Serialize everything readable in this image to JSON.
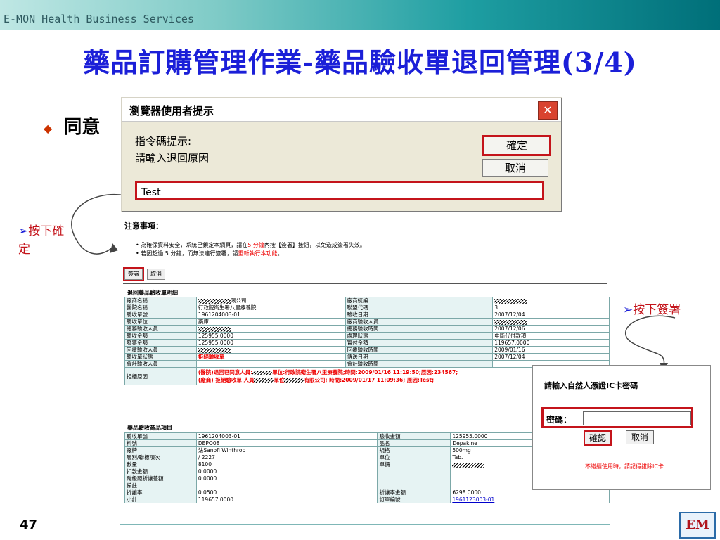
{
  "header": {
    "brand": "E-MON Health Business Services"
  },
  "title": "藥品訂購管理作業-藥品驗收單退回管理(3/4)",
  "bullet": {
    "text": "同意"
  },
  "page_number": "47",
  "logo_text": "EM",
  "annotations": {
    "press_ok": "按下確定",
    "press_sign": "按下簽署"
  },
  "dialog": {
    "caption": "瀏覽器使用者提示",
    "close_glyph": "✕",
    "prompt_label": "指令碼提示:",
    "prompt_text": "請輸入退回原因",
    "ok_label": "確定",
    "cancel_label": "取消",
    "input_value": "Test"
  },
  "notice": {
    "heading": "注意事項：",
    "line1_a": "為確保資料安全，系統已鎖定本網頁，請在",
    "line1_b": "5 分鐘",
    "line1_c": "內按【簽署】按鈕，以免造成簽署失效。",
    "line2_a": "若因超過 5 分鐘，而無法進行簽署，請",
    "line2_b": "重新執行本功能",
    "line2_c": "。",
    "sign_button": "簽署",
    "cancel_button": "取消"
  },
  "receipt": {
    "section_title": "退回藥品驗收單明細",
    "rows": [
      [
        "廠商名稱",
        "限公司",
        "廠商統編",
        ""
      ],
      [
        "醫院名稱",
        "行政院衛生署八里療養院",
        "聯盟代碼",
        "3"
      ],
      [
        "驗收單號",
        "1961204003-01",
        "驗收日期",
        "2007/12/04"
      ],
      [
        "驗收單位",
        "藥庫",
        "廠商驗收人員",
        ""
      ],
      [
        "總務驗收人員",
        "",
        "總務驗收時間",
        "2007/12/06"
      ],
      [
        "驗收金額",
        "125955.0000",
        "處理狀態",
        "中斷代付款項"
      ],
      [
        "發票金額",
        "125955.0000",
        "實付金額",
        "119657.0000"
      ],
      [
        "回覆驗收人員",
        "",
        "回覆驗收時間",
        "2009/01/16"
      ],
      [
        "驗收單狀態",
        "拒絕驗收單",
        "傳送日期",
        "2007/12/04"
      ],
      [
        "會計驗收人員",
        "",
        "會計驗收時間",
        ""
      ]
    ],
    "reject_label": "拒絕原因",
    "reject_line1_a": "(醫院)退回已同意人員:",
    "reject_line1_b": "單位:行政院衛生署八里療養院;時間:2009/01/16 11:19:50;原因:234567;",
    "reject_line2_a": "(廠商) 拒絕驗收單 人員",
    "reject_line2_b": "單位",
    "reject_line2_c": "有限公司; 時間:2009/01/17 11:09:36; 原因:Test;"
  },
  "items": {
    "section_title": "藥品驗收商品項目",
    "rows": [
      [
        "驗收單號",
        "1961204003-01",
        "驗收金額",
        "125955.0000"
      ],
      [
        "料號",
        "DEPO08",
        "品名",
        "Depakine"
      ],
      [
        "廠牌",
        "法Sanofi Winthrop",
        "規格",
        "500mg"
      ],
      [
        "層別/聯標項次",
        "/ 2227",
        "單位",
        "Tab."
      ],
      [
        "數量",
        "8100",
        "單價",
        ""
      ],
      [
        "扣款金額",
        "0.0000",
        "",
        ""
      ],
      [
        "跨級距折讓差額",
        "0.0000",
        "",
        ""
      ],
      [
        "備註",
        "",
        "",
        ""
      ],
      [
        "折讓率",
        "0.0500",
        "折讓率金額",
        "6298.0000"
      ],
      [
        "小計",
        "119657.0000",
        "訂單編號",
        "1961123003-01"
      ]
    ]
  },
  "ic_popup": {
    "title": "請輸入自然人憑證IC卡密碼",
    "password_label": "密碼：",
    "ok_label": "確認",
    "cancel_label": "取消",
    "warning": "不繼續使用時，請記得拔除IC卡"
  },
  "colors": {
    "title_blue": "#1b1fd8",
    "highlight_red": "#c4141b",
    "teal": "#1e9ea2"
  }
}
